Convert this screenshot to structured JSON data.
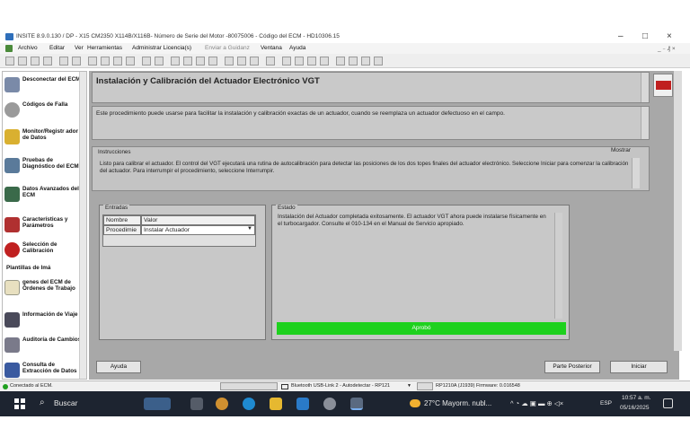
{
  "window": {
    "title": "INSITE 8.9.0.130  / DP - X15 CM2350 X114B/X116B- Número de Serie del Motor -80075006 - Código del ECM - HD10306.15",
    "controls": {
      "minimize": "–",
      "maximize": "□",
      "close": "×"
    }
  },
  "menu": {
    "items": [
      "Archivo",
      "Editar",
      "Ver",
      "Herramientas",
      "Administrar Licencia(s)",
      "Enviar a Guidanz",
      "Ventana",
      "Ayuda"
    ],
    "right": "_ ₋ ₰ ×"
  },
  "sidebar": {
    "items": [
      {
        "label": "Desconectar del ECM",
        "icon": "disconnect-icon"
      },
      {
        "label": "Códigos de Falla",
        "icon": "fault-codes-icon"
      },
      {
        "label": "Monitor/Registr ador de Datos",
        "icon": "data-monitor-icon"
      },
      {
        "label": "Pruebas de Diagnóstico del ECM",
        "icon": "diagnostic-tests-icon"
      },
      {
        "label": "Datos Avanzados del ECM",
        "icon": "advanced-data-icon"
      },
      {
        "label": "Características y Parámetros",
        "icon": "features-icon"
      },
      {
        "label": "Selección de Calibración",
        "icon": "calibration-icon"
      },
      {
        "label": "Plantillas de Imá",
        "icon": ""
      },
      {
        "label": "genes del ECM de Órdenes de Trabajo",
        "icon": "work-orders-icon"
      },
      {
        "label": "Información de Viaje",
        "icon": "trip-info-icon"
      },
      {
        "label": "Auditoría de Cambios",
        "icon": "audit-icon"
      },
      {
        "label": "Consulta de Extracción de Datos",
        "icon": "data-extraction-icon"
      }
    ]
  },
  "content": {
    "heading": "Instalación y Calibración del Actuador Electrónico VGT",
    "description": "Este procedimiento puede usarse para facilitar la instalación y calibración exactas de un actuador, cuando se reemplaza un actuador defectuoso en el campo.",
    "instructions_title": "Instrucciones",
    "show_label": "Mostrar",
    "instructions_text": "Listo para calibrar el actuador. El control del VGT ejecutará una rutina de autocalibración para detectar las posiciones de los dos topes finales del actuador electrónico. Seleccione Iniciar para comenzar la calibración del actuador. Para interrumpir el procedimiento, seleccione Interrumpir.",
    "inputs_title": "Entradas",
    "inputs_header": {
      "name": "Nombre",
      "value": "Valor"
    },
    "inputs_row": {
      "name": "Procedimie",
      "value": "Instalar Actuador"
    },
    "status_title": "Estado",
    "status_text": "Instalación del Actuador completada exitosamente. El actuador VGT ahora puede instalarse físicamente en el turbocargador. Consulte el 010-134 en el Manual de Servicio apropiado.",
    "progress_label": "Aprobó",
    "progress_value": 1.0
  },
  "buttons": {
    "help": "Ayuda",
    "back": "Parte Posterior",
    "start": "Iniciar"
  },
  "statusbar": {
    "connection": "Conectado al ECM.",
    "adapter": "Bluetooth USB-Link 2 - Autodetectar - RP121",
    "firmware": "RP1210A (J1939)  Firmware: 0.016548"
  },
  "taskbar": {
    "search": "Buscar",
    "weather": "27°C  Mayorm. nubl...",
    "lang": "ESP",
    "time": "10:57 a. m.",
    "date": "05/16/2025"
  },
  "colors": {
    "progress": "#1ed11e",
    "taskbar": "#1d2430",
    "panel": "#a8a8a8"
  }
}
